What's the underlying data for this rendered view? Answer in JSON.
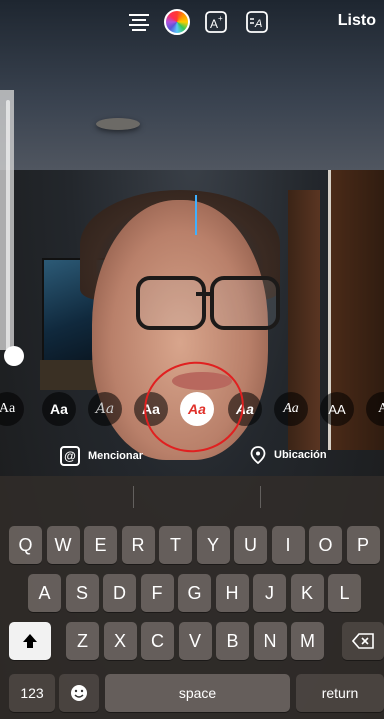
{
  "topbar": {
    "align_icon": "text-align-icon",
    "color_icon": "color-wheel-icon",
    "effects_icon": "text-effect-icon",
    "animate_icon": "text-animate-icon",
    "done_label": "Listo"
  },
  "fonts": [
    {
      "label": "Aa",
      "style": "classic"
    },
    {
      "label": "Aa",
      "style": "modern-bold"
    },
    {
      "label": "Aa",
      "style": "script"
    },
    {
      "label": "Aa",
      "style": "neon"
    },
    {
      "label": "Aa",
      "style": "selected-italic-red"
    },
    {
      "label": "Aa",
      "style": "italic-bold"
    },
    {
      "label": "Aa",
      "style": "serif-italic"
    },
    {
      "label": "AA",
      "style": "uppercase"
    },
    {
      "label": "A",
      "style": "serif"
    }
  ],
  "actions": {
    "mention_label": "Mencionar",
    "location_label": "Ubicación"
  },
  "keyboard": {
    "row1": [
      "Q",
      "W",
      "E",
      "R",
      "T",
      "Y",
      "U",
      "I",
      "O",
      "P"
    ],
    "row2": [
      "A",
      "S",
      "D",
      "F",
      "G",
      "H",
      "J",
      "K",
      "L"
    ],
    "row3": [
      "Z",
      "X",
      "C",
      "V",
      "B",
      "N",
      "M"
    ],
    "numbers_label": "123",
    "space_label": "space",
    "return_label": "return"
  },
  "colors": {
    "accent_cursor": "#3fb0ff",
    "selected_font_text": "#e0302a",
    "annotation": "#e02020"
  }
}
